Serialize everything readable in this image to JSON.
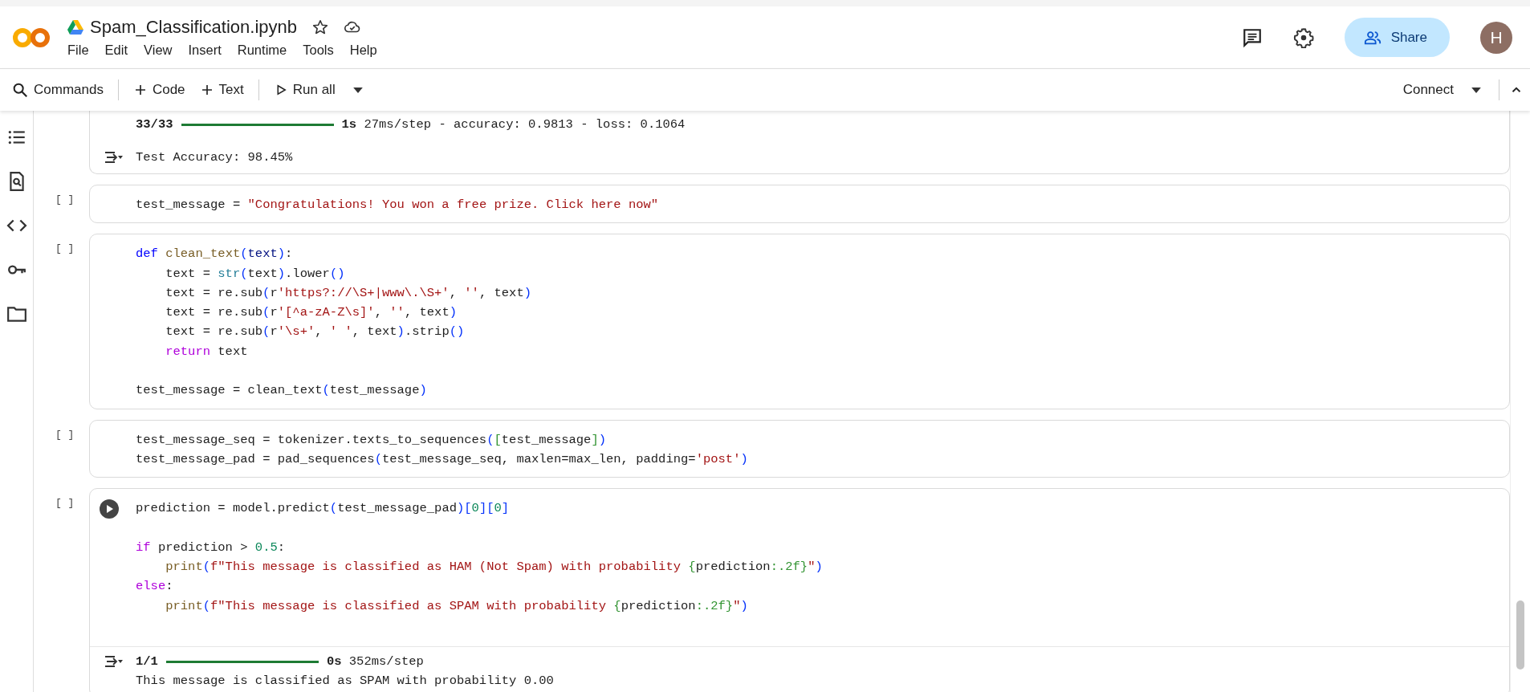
{
  "header": {
    "title": "Spam_Classification.ipynb",
    "menu": [
      "File",
      "Edit",
      "View",
      "Insert",
      "Runtime",
      "Tools",
      "Help"
    ],
    "share_label": "Share",
    "avatar_initial": "H"
  },
  "toolbar": {
    "commands": "Commands",
    "add_code": "Code",
    "add_text": "Text",
    "run_all": "Run all",
    "connect": "Connect"
  },
  "cells": [
    {
      "hovered": false,
      "output": [
        {
          "kind": "progress",
          "marker": false,
          "gap_before": false,
          "step": "33/33",
          "level": 1,
          "time": "1s",
          "stats": "27ms/step - accuracy: 0.9813 - loss: 0.1064"
        },
        {
          "kind": "text",
          "marker": true,
          "gap_before": true,
          "text": "Test Accuracy: 98.45%"
        }
      ]
    },
    {
      "bracket": "[ ]",
      "hovered": false,
      "code": [
        {
          "gap_before": false,
          "indented": false,
          "tokens": [
            {
              "kind": "plain",
              "text": "test_message = "
            },
            {
              "kind": "string",
              "text": "\"Congratulations! You won a free prize. Click here now\""
            }
          ]
        }
      ]
    },
    {
      "bracket": "[ ]",
      "hovered": false,
      "code": [
        {
          "gap_before": false,
          "indented": false,
          "tokens": [
            {
              "kind": "keyword",
              "text": "def "
            },
            {
              "kind": "function",
              "text": "clean_text"
            },
            {
              "kind": "bracket",
              "text": "("
            },
            {
              "kind": "param",
              "text": "text"
            },
            {
              "kind": "bracket",
              "text": ")"
            },
            {
              "kind": "plain",
              "text": ":"
            }
          ]
        },
        {
          "gap_before": false,
          "indented": true,
          "tokens": [
            {
              "kind": "plain",
              "text": "text = "
            },
            {
              "kind": "builtin",
              "text": "str"
            },
            {
              "kind": "bracket",
              "text": "("
            },
            {
              "kind": "plain",
              "text": "text"
            },
            {
              "kind": "bracket",
              "text": ")"
            },
            {
              "kind": "plain",
              "text": ".lower"
            },
            {
              "kind": "bracket",
              "text": "()"
            }
          ]
        },
        {
          "gap_before": false,
          "indented": true,
          "tokens": [
            {
              "kind": "plain",
              "text": "text = re.sub"
            },
            {
              "kind": "bracket",
              "text": "("
            },
            {
              "kind": "plain",
              "text": "r"
            },
            {
              "kind": "string",
              "text": "'https?://\\S+|www\\.\\S+'"
            },
            {
              "kind": "plain",
              "text": ", "
            },
            {
              "kind": "string",
              "text": "''"
            },
            {
              "kind": "plain",
              "text": ", text"
            },
            {
              "kind": "bracket",
              "text": ")"
            }
          ]
        },
        {
          "gap_before": false,
          "indented": true,
          "tokens": [
            {
              "kind": "plain",
              "text": "text = re.sub"
            },
            {
              "kind": "bracket",
              "text": "("
            },
            {
              "kind": "plain",
              "text": "r"
            },
            {
              "kind": "string",
              "text": "'[^a-zA-Z\\s]'"
            },
            {
              "kind": "plain",
              "text": ", "
            },
            {
              "kind": "string",
              "text": "''"
            },
            {
              "kind": "plain",
              "text": ", text"
            },
            {
              "kind": "bracket",
              "text": ")"
            }
          ]
        },
        {
          "gap_before": false,
          "indented": true,
          "tokens": [
            {
              "kind": "plain",
              "text": "text = re.sub"
            },
            {
              "kind": "bracket",
              "text": "("
            },
            {
              "kind": "plain",
              "text": "r"
            },
            {
              "kind": "string",
              "text": "'\\s+'"
            },
            {
              "kind": "plain",
              "text": ", "
            },
            {
              "kind": "string",
              "text": "' '"
            },
            {
              "kind": "plain",
              "text": ", text"
            },
            {
              "kind": "bracket",
              "text": ")"
            },
            {
              "kind": "plain",
              "text": ".strip"
            },
            {
              "kind": "bracket",
              "text": "()"
            }
          ]
        },
        {
          "gap_before": false,
          "indented": true,
          "tokens": [
            {
              "kind": "control",
              "text": "return"
            },
            {
              "kind": "plain",
              "text": " text"
            }
          ]
        },
        {
          "gap_before": true,
          "indented": false,
          "tokens": [
            {
              "kind": "plain",
              "text": "test_message = clean_text"
            },
            {
              "kind": "bracket",
              "text": "("
            },
            {
              "kind": "plain",
              "text": "test_message"
            },
            {
              "kind": "bracket",
              "text": ")"
            }
          ]
        }
      ]
    },
    {
      "bracket": "[ ]",
      "hovered": false,
      "code": [
        {
          "gap_before": false,
          "indented": false,
          "tokens": [
            {
              "kind": "plain",
              "text": "test_message_seq = tokenizer.texts_to_sequences"
            },
            {
              "kind": "bracket",
              "text": "("
            },
            {
              "kind": "bracket2",
              "text": "["
            },
            {
              "kind": "plain",
              "text": "test_message"
            },
            {
              "kind": "bracket2",
              "text": "]"
            },
            {
              "kind": "bracket",
              "text": ")"
            }
          ]
        },
        {
          "gap_before": false,
          "indented": false,
          "tokens": [
            {
              "kind": "plain",
              "text": "test_message_pad = pad_sequences"
            },
            {
              "kind": "bracket",
              "text": "("
            },
            {
              "kind": "plain",
              "text": "test_message_seq, maxlen=max_len, padding="
            },
            {
              "kind": "string",
              "text": "'post'"
            },
            {
              "kind": "bracket",
              "text": ")"
            }
          ]
        }
      ]
    },
    {
      "bracket": "[ ]",
      "hovered": true,
      "code": [
        {
          "gap_before": false,
          "indented": false,
          "tokens": [
            {
              "kind": "plain",
              "text": "prediction = model.predict"
            },
            {
              "kind": "bracket",
              "text": "("
            },
            {
              "kind": "plain",
              "text": "test_message_pad"
            },
            {
              "kind": "bracket",
              "text": ")["
            },
            {
              "kind": "number",
              "text": "0"
            },
            {
              "kind": "bracket",
              "text": "]["
            },
            {
              "kind": "number",
              "text": "0"
            },
            {
              "kind": "bracket",
              "text": "]"
            }
          ]
        },
        {
          "gap_before": true,
          "indented": false,
          "tokens": [
            {
              "kind": "control",
              "text": "if"
            },
            {
              "kind": "plain",
              "text": " prediction > "
            },
            {
              "kind": "number",
              "text": "0.5"
            },
            {
              "kind": "plain",
              "text": ":"
            }
          ]
        },
        {
          "gap_before": false,
          "indented": true,
          "tokens": [
            {
              "kind": "function",
              "text": "print"
            },
            {
              "kind": "bracket",
              "text": "("
            },
            {
              "kind": "string",
              "text": "f\"This message is classified as HAM (Not Spam) with probability "
            },
            {
              "kind": "bracket2",
              "text": "{"
            },
            {
              "kind": "plain",
              "text": "prediction"
            },
            {
              "kind": "bracket2",
              "text": ":.2f}"
            },
            {
              "kind": "string",
              "text": "\""
            },
            {
              "kind": "bracket",
              "text": ")"
            }
          ]
        },
        {
          "gap_before": false,
          "indented": false,
          "tokens": [
            {
              "kind": "control",
              "text": "else"
            },
            {
              "kind": "plain",
              "text": ":"
            }
          ]
        },
        {
          "gap_before": false,
          "indented": true,
          "tokens": [
            {
              "kind": "function",
              "text": "print"
            },
            {
              "kind": "bracket",
              "text": "("
            },
            {
              "kind": "string",
              "text": "f\"This message is classified as SPAM with probability "
            },
            {
              "kind": "bracket2",
              "text": "{"
            },
            {
              "kind": "plain",
              "text": "prediction"
            },
            {
              "kind": "bracket2",
              "text": ":.2f}"
            },
            {
              "kind": "string",
              "text": "\""
            },
            {
              "kind": "bracket",
              "text": ")"
            }
          ]
        }
      ],
      "output": [
        {
          "kind": "progress",
          "marker": true,
          "gap_before": false,
          "step": "1/1",
          "level": 1,
          "time": "0s",
          "stats": "352ms/step"
        },
        {
          "kind": "text",
          "marker": false,
          "gap_before": false,
          "text": "This message is classified as SPAM with probability 0.00"
        }
      ]
    }
  ]
}
